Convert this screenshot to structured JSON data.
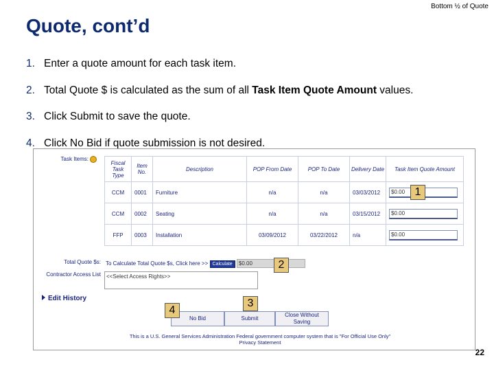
{
  "header": {
    "top_note": "Bottom ½ of Quote",
    "title": "Quote, cont’d"
  },
  "steps": [
    {
      "num": "1.",
      "text": "Enter a quote amount for each task item."
    },
    {
      "num": "2.",
      "text_before": "Total Quote $ is calculated as the sum of all ",
      "bold": "Task Item Quote Amount",
      "text_after": " values."
    },
    {
      "num": "3.",
      "text": "Click Submit to save the quote."
    },
    {
      "num": "4.",
      "text": "Click No Bid if quote submission is not desired."
    }
  ],
  "form": {
    "task_items_label": "Task Items:",
    "columns": [
      "Fiscal Task Type",
      "Item No.",
      "Description",
      "POP From Date",
      "POP To Date",
      "Delivery Date",
      "Task Item Quote Amount"
    ],
    "rows": [
      {
        "type": "CCM",
        "item": "0001",
        "description": "Furniture",
        "pop_from": "n/a",
        "pop_to": "n/a",
        "delivery": "03/03/2012",
        "amount": "$0.00"
      },
      {
        "type": "CCM",
        "item": "0002",
        "description": "Seating",
        "pop_from": "n/a",
        "pop_to": "n/a",
        "delivery": "03/15/2012",
        "amount": "$0.00"
      },
      {
        "type": "FFP",
        "item": "0003",
        "description": "Installation",
        "pop_from": "03/09/2012",
        "pop_to": "03/22/2012",
        "delivery": "n/a",
        "amount": "$0.00"
      }
    ],
    "total_label": "Total Quote $s:",
    "calc_text": "To Calculate Total Quote $s, Click here >>",
    "calc_button": "Calculate",
    "total_value": "$0.00",
    "access_label": "Contractor Access List",
    "access_value": "<<Select Access Rights>>",
    "edit_history": "Edit History",
    "buttons": {
      "no_bid": "No Bid",
      "submit": "Submit",
      "close": "Close Without Saving"
    },
    "footer_line1": "This is a U.S. General Services Administration Federal government computer system that is \"For Official Use Only\"",
    "footer_line2": "Privacy Statement"
  },
  "callouts": [
    "1",
    "2",
    "3",
    "4"
  ],
  "page_number": "22",
  "colors": {
    "title": "#0e2a6e",
    "callout": "#e8c87a",
    "link": "#1a237e"
  }
}
